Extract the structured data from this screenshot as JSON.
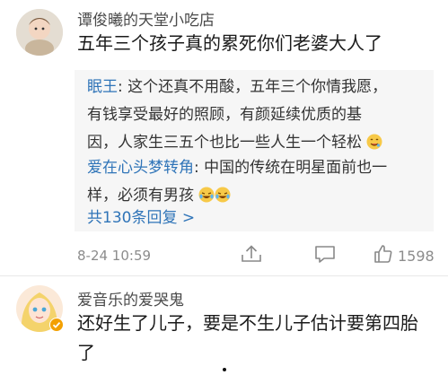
{
  "comments": [
    {
      "username": "谭俊曦的天堂小吃店",
      "text": "五年三个孩子真的累死你们老婆大人了",
      "replies": [
        {
          "name": "眠王",
          "separator": ":",
          "lines": [
            "这个还真不用酸，五年三个你情我愿，",
            "有钱享受最好的照顾，有颜延续优质的基",
            "因，人家生三五个也比一些人生一个轻松"
          ],
          "emoji": [
            "drooling-face-icon"
          ]
        },
        {
          "name": "爱在心头梦转角",
          "separator": ":",
          "lines": [
            "中国的传统在明星面前也一",
            "样，必须有男孩"
          ],
          "emoji": [
            "laughing-crying-icon",
            "laughing-crying-icon"
          ]
        }
      ],
      "more_replies": "共130条回复 >",
      "date": "8-24 10:59",
      "like_count": "1598"
    },
    {
      "username": "爱音乐的爱哭鬼",
      "text_lines": [
        "还好生了儿子，要是不生儿子估计要第四胎",
        "了"
      ],
      "badge": "verified-badge-icon"
    }
  ],
  "colors": {
    "link": "#2f74b8",
    "meta": "#8c8c8c",
    "reply_bg": "#f6f6f6"
  }
}
